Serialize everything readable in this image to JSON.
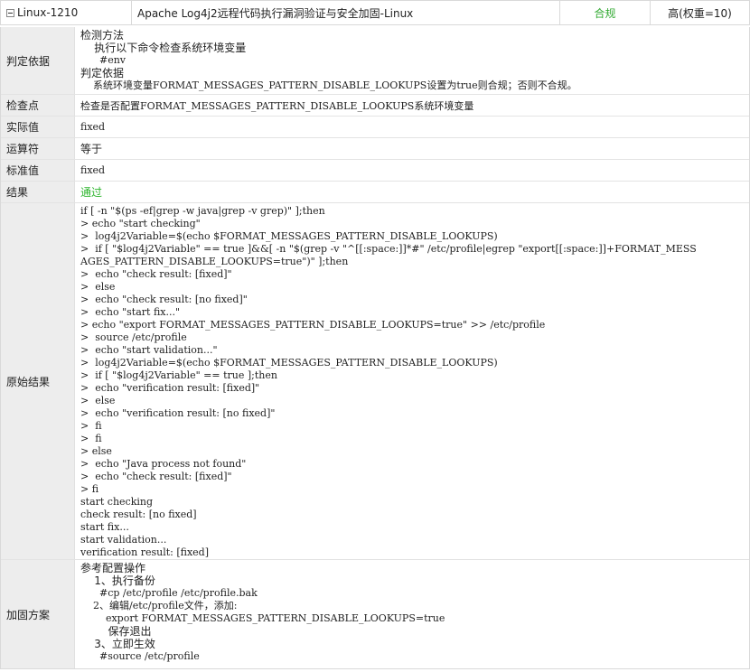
{
  "header": {
    "id": "Linux-1210",
    "title": "Apache Log4j2远程代码执行漏洞验证与安全加固-Linux",
    "status": "合规",
    "level": "高(权重=10)",
    "status_color": "#33aa33"
  },
  "rows": {
    "basis": {
      "label": "判定依据",
      "lines": [
        "检测方法",
        "    执行以下命令检查系统环境变量",
        "      #env",
        "判定依据",
        "    系统环境变量FORMAT_MESSAGES_PATTERN_DISABLE_LOOKUPS设置为true则合规；否则不合规。"
      ]
    },
    "check_point": {
      "label": "检查点",
      "value": "检查是否配置FORMAT_MESSAGES_PATTERN_DISABLE_LOOKUPS系统环境变量"
    },
    "actual": {
      "label": "实际值",
      "value": "fixed"
    },
    "operator": {
      "label": "运算符",
      "value": "等于"
    },
    "standard": {
      "label": "标准值",
      "value": "fixed"
    },
    "result": {
      "label": "结果",
      "value": "通过",
      "color": "#2db52d"
    },
    "raw": {
      "label": "原始结果",
      "lines": [
        "if [ -n \"$(ps -ef|grep -w java|grep -v grep)\" ];then",
        "> echo \"start checking\"",
        ">  log4j2Variable=$(echo $FORMAT_MESSAGES_PATTERN_DISABLE_LOOKUPS)",
        ">  if [ \"$log4j2Variable\" == true ]&&[ -n \"$(grep -v \"^[[:space:]]*#\" /etc/profile|egrep \"export[[:space:]]+FORMAT_MESS",
        "AGES_PATTERN_DISABLE_LOOKUPS=true\")\" ];then",
        ">  echo \"check result: [fixed]\"",
        ">  else",
        ">  echo \"check result: [no fixed]\"",
        ">  echo \"start fix...\"",
        "> echo \"export FORMAT_MESSAGES_PATTERN_DISABLE_LOOKUPS=true\" >> /etc/profile",
        ">  source /etc/profile",
        ">  echo \"start validation...\"",
        ">  log4j2Variable=$(echo $FORMAT_MESSAGES_PATTERN_DISABLE_LOOKUPS)",
        ">  if [ \"$log4j2Variable\" == true ];then",
        ">  echo \"verification result: [fixed]\"",
        ">  else",
        ">  echo \"verification result: [no fixed]\"",
        ">  fi",
        ">  fi",
        "> else",
        ">  echo \"Java process not found\"",
        ">  echo \"check result: [fixed]\"",
        "> fi",
        "start checking",
        "check result: [no fixed]",
        "start fix...",
        "start validation...",
        "verification result: [fixed]"
      ]
    },
    "fix": {
      "label": "加固方案",
      "lines": [
        "参考配置操作",
        "    1、执行备份",
        "      #cp /etc/profile /etc/profile.bak",
        "    2、编辑/etc/profile文件，添加:",
        "        export FORMAT_MESSAGES_PATTERN_DISABLE_LOOKUPS=true",
        "        保存退出",
        "    3、立即生效",
        "      #source /etc/profile"
      ]
    }
  }
}
